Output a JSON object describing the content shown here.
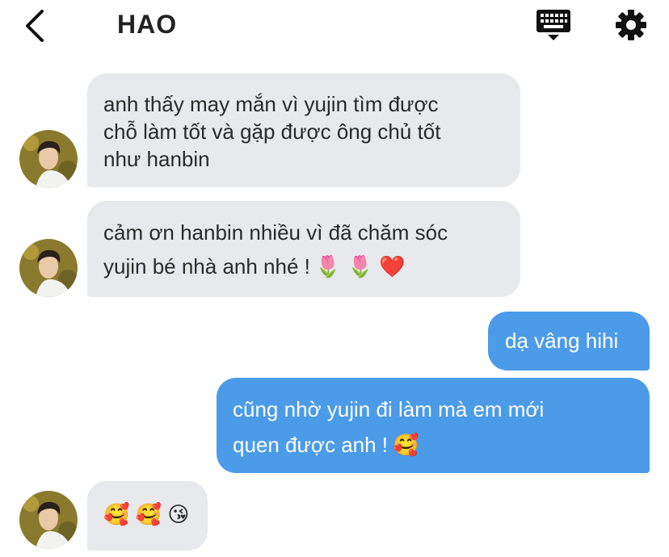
{
  "header": {
    "title": "HAO",
    "back_icon": "chevron-left-icon",
    "keyboard_icon": "keyboard-icon",
    "settings_icon": "gear-icon"
  },
  "colors": {
    "incoming_bubble": "#e7e9ed",
    "outgoing_bubble": "#4b9be8",
    "outgoing_text": "#ffffff",
    "incoming_text": "#2a2a2a"
  },
  "messages": [
    {
      "sender": "incoming",
      "lines": [
        "anh thấy may mắn vì yujin tìm được",
        "chỗ làm tốt và gặp được ông chủ tốt",
        "như hanbin"
      ]
    },
    {
      "sender": "incoming",
      "lines": [
        "cảm ơn hanbin nhiều vì đã chăm sóc",
        "yujin bé nhà anh nhé !"
      ],
      "emoji": "🌷 🌷 ❤️"
    },
    {
      "sender": "outgoing",
      "lines": [
        "dạ vâng hihi"
      ]
    },
    {
      "sender": "outgoing",
      "lines": [
        "cũng nhờ yujin đi làm mà em mới",
        "quen được anh !"
      ],
      "emoji": "🥰"
    },
    {
      "sender": "incoming",
      "lines": [
        ""
      ],
      "emoji": "🥰 🥰 😘"
    }
  ]
}
